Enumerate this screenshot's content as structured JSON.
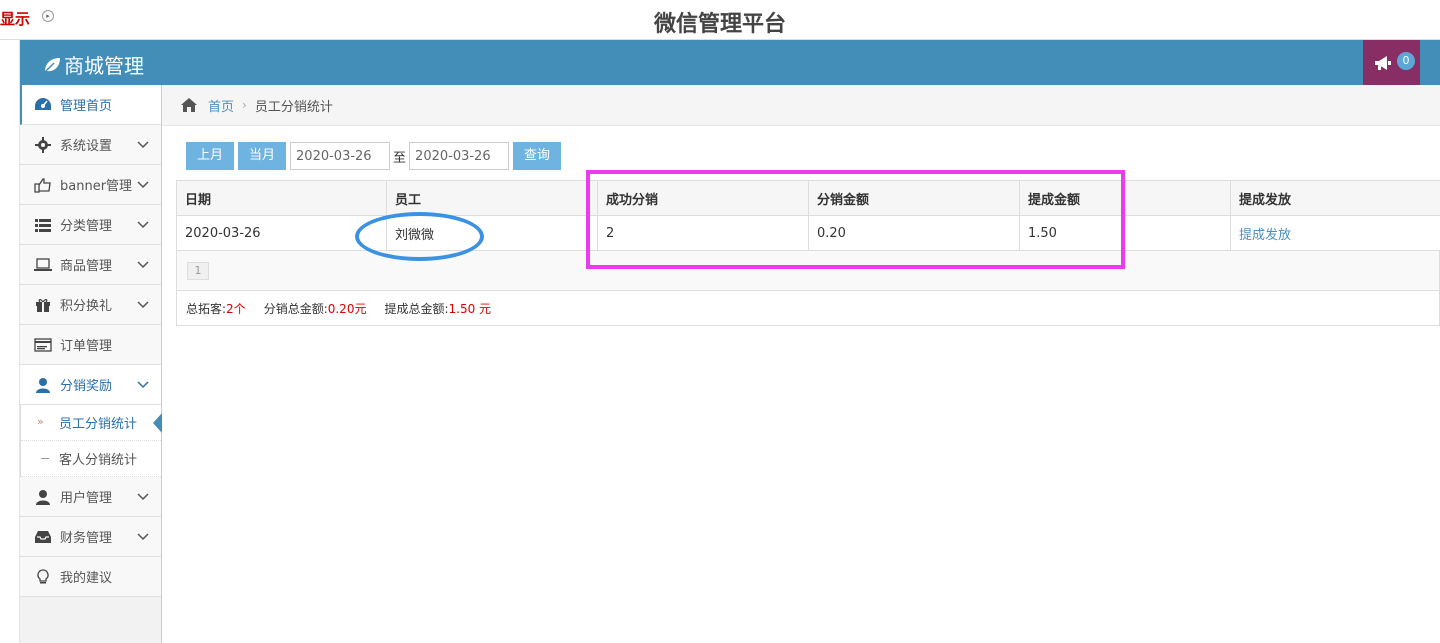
{
  "topbar": {
    "show_label": "显示",
    "platform_title": "微信管理平台"
  },
  "navbar": {
    "brand": "商城管理",
    "notify_count": "0"
  },
  "sidebar": {
    "items": [
      {
        "label": "管理首页",
        "icon": "dashboard-icon",
        "active": true
      },
      {
        "label": "系统设置",
        "icon": "gear-icon"
      },
      {
        "label": "banner管理",
        "icon": "thumbs-up-icon"
      },
      {
        "label": "分类管理",
        "icon": "list-icon"
      },
      {
        "label": "商品管理",
        "icon": "laptop-icon"
      },
      {
        "label": "积分换礼",
        "icon": "gift-icon"
      },
      {
        "label": "订单管理",
        "icon": "card-icon"
      },
      {
        "label": "分销奖励",
        "icon": "user-icon",
        "open": true
      },
      {
        "label": "用户管理",
        "icon": "user-icon"
      },
      {
        "label": "财务管理",
        "icon": "inbox-icon"
      },
      {
        "label": "我的建议",
        "icon": "lightbulb-icon"
      }
    ],
    "sub_items": [
      {
        "label": "员工分销统计",
        "active": true
      },
      {
        "label": "客人分销统计"
      }
    ]
  },
  "breadcrumb": {
    "home": "首页",
    "current": "员工分销统计"
  },
  "filter": {
    "prev_month": "上月",
    "this_month": "当月",
    "start_date": "2020-03-26",
    "to": "至",
    "end_date": "2020-03-26",
    "query": "查询"
  },
  "table": {
    "headers": [
      "日期",
      "员工",
      "",
      "成功分销",
      "分销金额",
      "提成金额",
      "提成发放"
    ],
    "rows": [
      [
        "2020-03-26",
        "刘微微",
        "",
        "2",
        "0.20",
        "1.50",
        "提成发放"
      ]
    ]
  },
  "pager": {
    "page": "1"
  },
  "summary": {
    "total_customers_label": "总拓客:",
    "total_customers": "2个",
    "total_sales_label": "分销总金额:",
    "total_sales": "0.20元",
    "total_commission_label": "提成总金额:",
    "total_commission": "1.50 元"
  },
  "colors": {
    "navbar": "#438eb9",
    "notify": "#892e65",
    "button": "#6fb3e0",
    "annotation_rect": "#ee3aee",
    "annotation_ellipse": "#3c92e2"
  }
}
